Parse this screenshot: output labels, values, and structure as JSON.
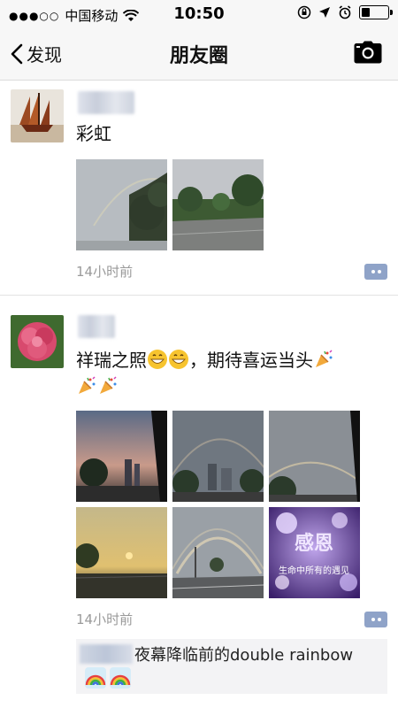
{
  "status_bar": {
    "carrier": "中国移动",
    "time": "10:50"
  },
  "nav": {
    "back_label": "发现",
    "title": "朋友圈"
  },
  "posts": [
    {
      "text": "彩虹",
      "timestamp": "14小时前",
      "image_count": 2
    },
    {
      "text_part1": "祥瑞之照",
      "text_part2": "，期待喜运当头",
      "timestamp": "14小时前",
      "image_count": 6,
      "overlay_title": "感恩",
      "overlay_caption": "生命中所有的遇见",
      "comment_text": "夜幕降临前的double rainbow"
    }
  ],
  "colors": {
    "nav_bg": "#f7f7f7",
    "link_blue": "#576b95",
    "comment_icon": "#8fa3c8",
    "timestamp_gray": "#9a9a9a"
  },
  "icons": [
    "back-chevron-icon",
    "camera-icon",
    "wifi-icon",
    "location-icon",
    "alarm-icon",
    "lock-rotation-icon",
    "battery-icon",
    "comment-icon"
  ]
}
